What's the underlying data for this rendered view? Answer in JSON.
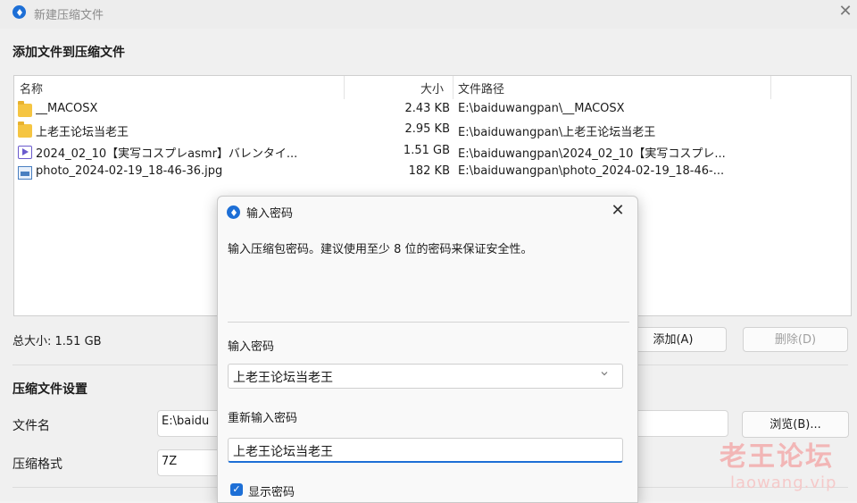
{
  "window": {
    "title": "新建压缩文件",
    "close_glyph": "✕"
  },
  "add_section": {
    "heading": "添加文件到压缩文件",
    "columns": {
      "name": "名称",
      "size": "大小",
      "path": "文件路径"
    },
    "files": [
      {
        "icon": "folder-icon",
        "name": "__MACOSX",
        "size": "2.43 KB",
        "path": "E:\\baiduwangpan\\__MACOSX"
      },
      {
        "icon": "folder-icon",
        "name": "上老王论坛当老王",
        "size": "2.95 KB",
        "path": "E:\\baiduwangpan\\上老王论坛当老王"
      },
      {
        "icon": "video-file-icon",
        "name": "2024_02_10【実写コスプレasmr】バレンタイ...",
        "size": "1.51 GB",
        "path": "E:\\baiduwangpan\\2024_02_10【実写コスプレ..."
      },
      {
        "icon": "image-file-icon",
        "name": "photo_2024-02-19_18-46-36.jpg",
        "size": "182 KB",
        "path": "E:\\baiduwangpan\\photo_2024-02-19_18-46-..."
      }
    ],
    "total_size": "总大小: 1.51 GB",
    "add_button": "添加(A)",
    "delete_button": "删除(D)"
  },
  "settings_section": {
    "heading": "压缩文件设置",
    "filename_label": "文件名",
    "filename_value": "E:\\baidu",
    "format_label": "压缩格式",
    "format_value": "7Z",
    "browse_button": "浏览(B)..."
  },
  "watermark": {
    "text": "老王论坛",
    "url": "laowang.vip"
  },
  "dialog": {
    "title": "输入密码",
    "close_glyph": "✕",
    "description": "输入压缩包密码。建议使用至少 8 位的密码来保证安全性。",
    "password_label": "输入密码",
    "password_value": "上老王论坛当老王",
    "confirm_label": "重新输入密码",
    "confirm_value": "上老王论坛当老王",
    "show_password_label": "显示密码",
    "show_password_checked": true
  },
  "colors": {
    "accent": "#1d6fd6"
  }
}
